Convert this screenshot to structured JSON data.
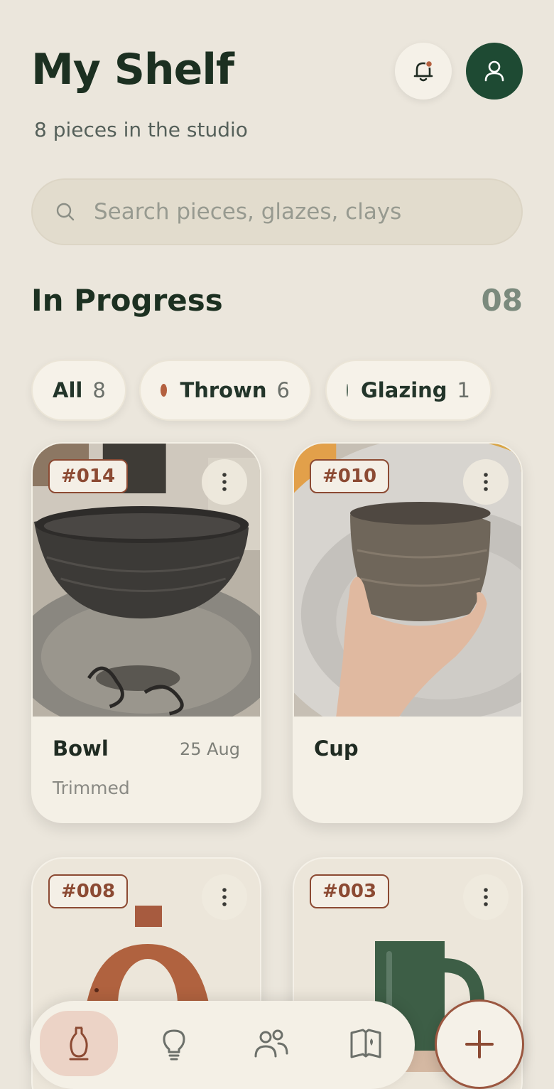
{
  "header": {
    "title": "My Shelf",
    "subtitle": "8 pieces in the studio"
  },
  "search": {
    "placeholder": "Search pieces, glazes, clays"
  },
  "section": {
    "title": "In Progress",
    "count": "08"
  },
  "filters": [
    {
      "label": "All",
      "count": "8",
      "dot_color": null
    },
    {
      "label": "Thrown",
      "count": "6",
      "dot_color": "#b4603f"
    },
    {
      "label": "Glazing",
      "count": "1",
      "dot_color": "#5a6e60"
    }
  ],
  "pieces": [
    {
      "id": "#014",
      "name": "Bowl",
      "date": "25 Aug",
      "stage": "Trimmed"
    },
    {
      "id": "#010",
      "name": "Cup",
      "date": "",
      "stage": ""
    },
    {
      "id": "#008",
      "name": "",
      "date": "",
      "stage": ""
    },
    {
      "id": "#003",
      "name": "",
      "date": "",
      "stage": ""
    }
  ],
  "nav": {
    "items": [
      "vase-icon",
      "lightbulb-icon",
      "people-icon",
      "book-icon"
    ],
    "active": 0
  },
  "colors": {
    "background": "#ebe6dc",
    "primary_dark_green": "#1e4a33",
    "terracotta": "#8c4a33",
    "card": "#f4f0e6"
  }
}
